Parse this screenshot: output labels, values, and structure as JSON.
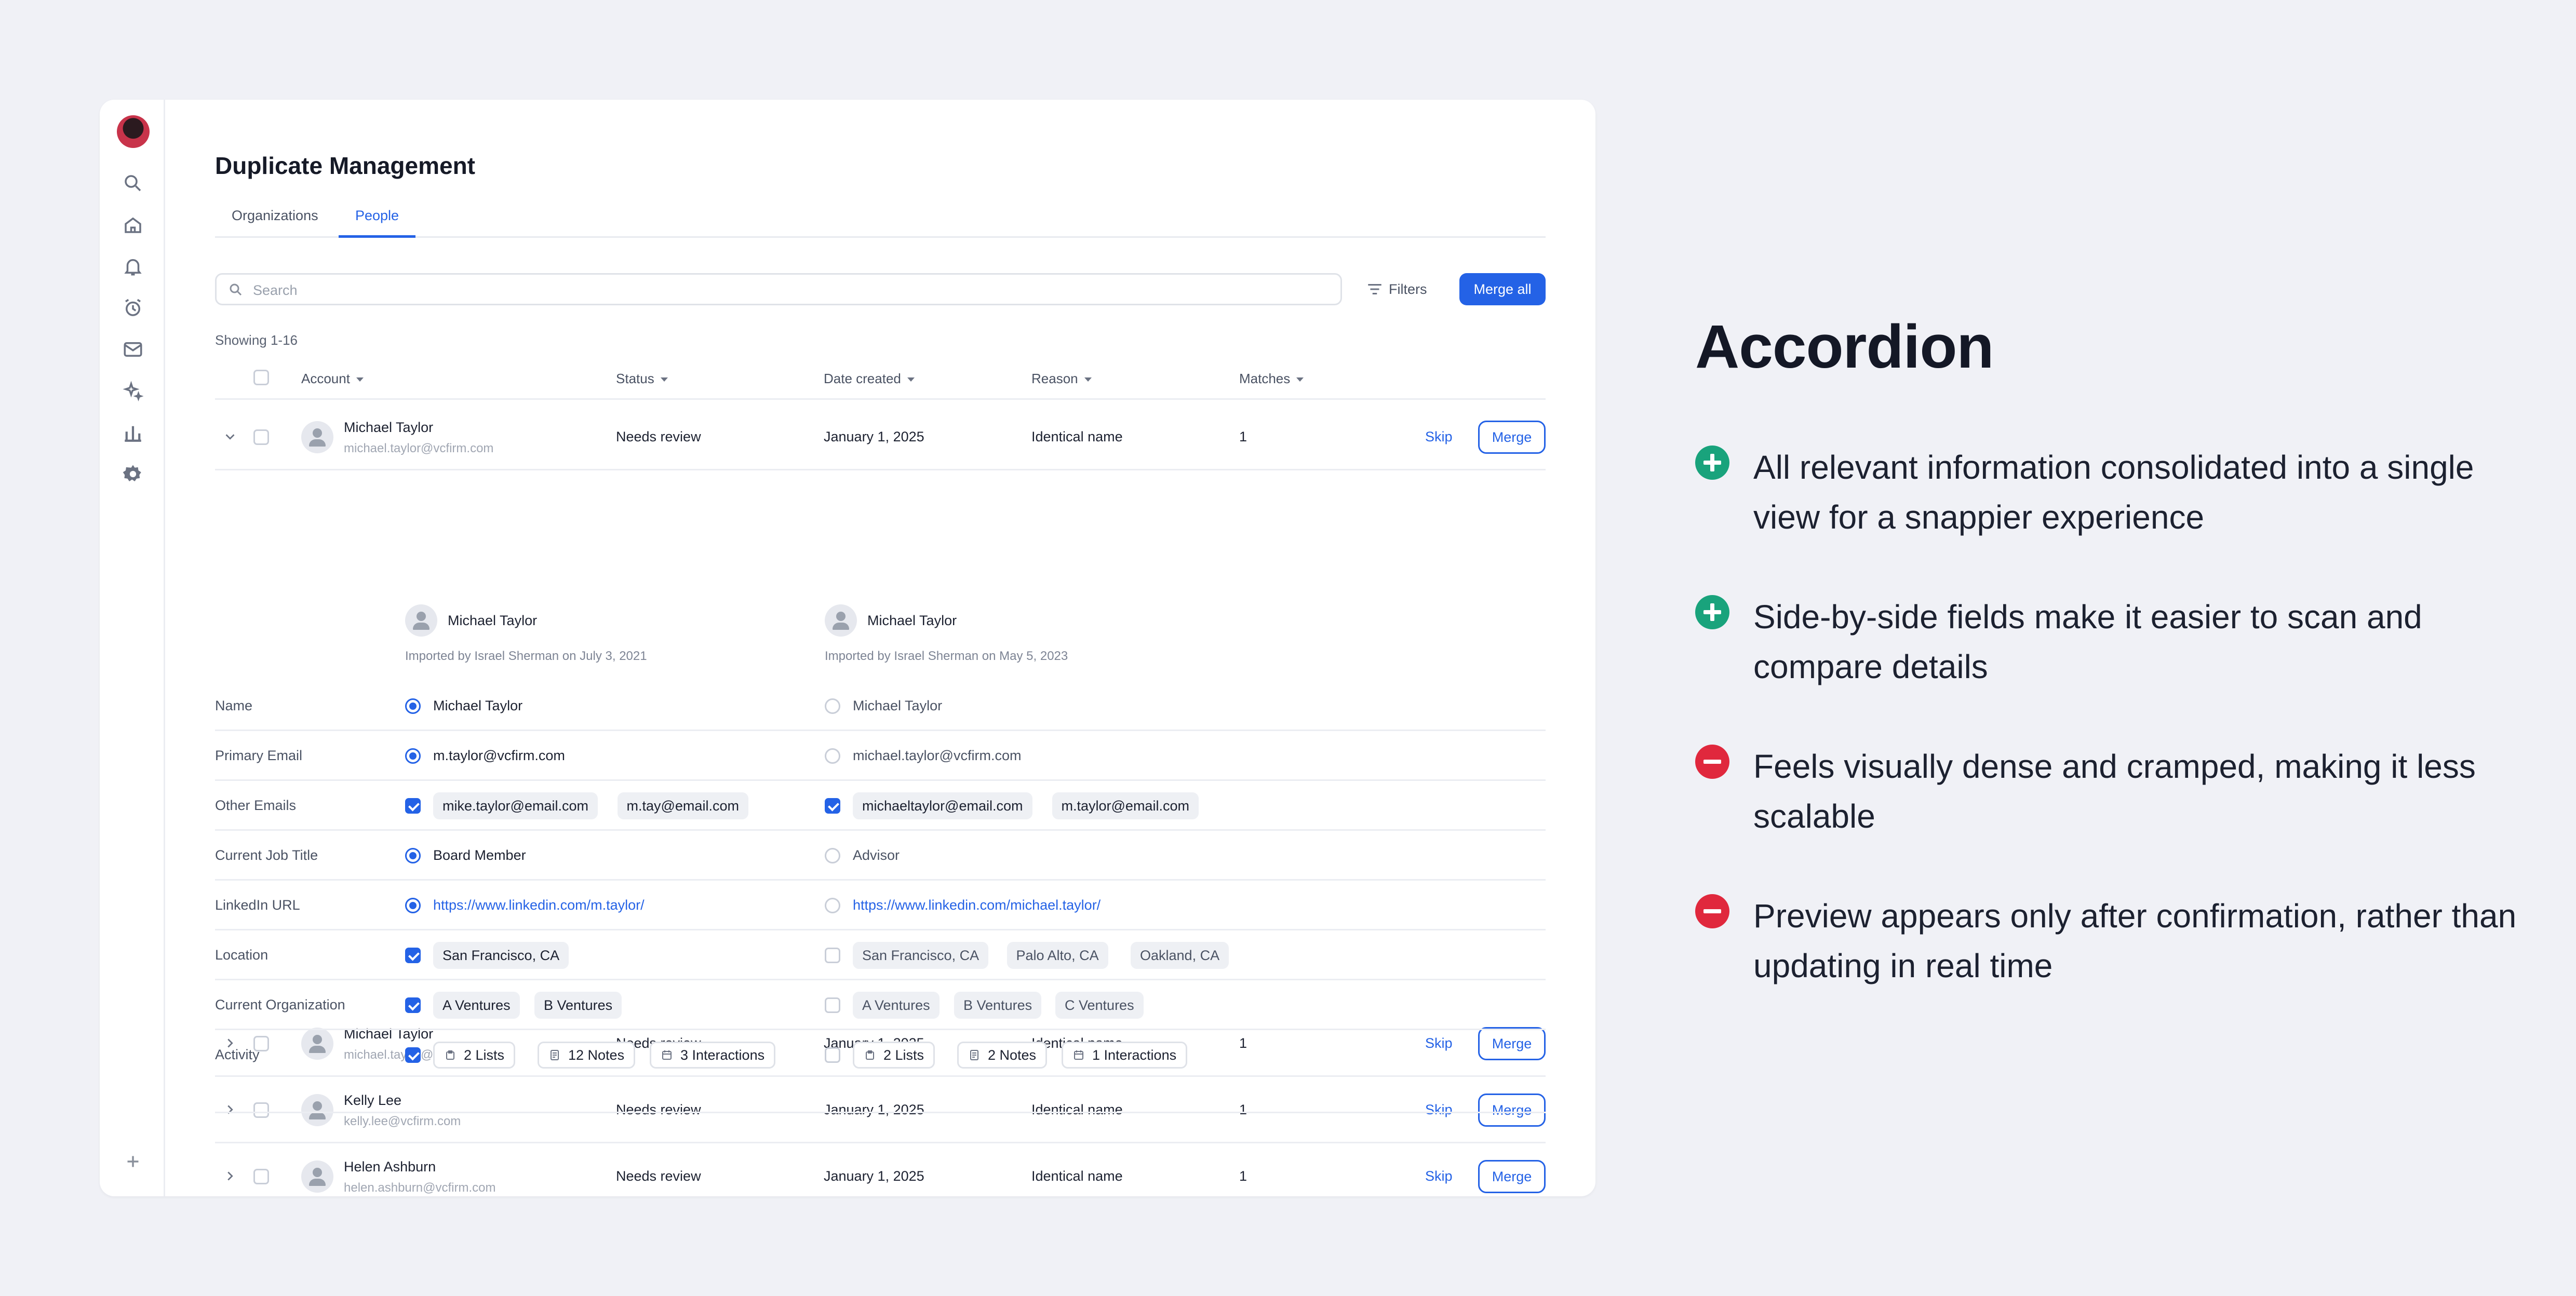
{
  "app": {
    "title": "Duplicate Management",
    "tabs": [
      {
        "label": "Organizations"
      },
      {
        "label": "People"
      }
    ],
    "search_placeholder": "Search",
    "filters_label": "Filters",
    "merge_all_label": "Merge all",
    "showing": "Showing 1-16",
    "columns": {
      "account": "Account",
      "status": "Status",
      "date": "Date created",
      "reason": "Reason",
      "matches": "Matches"
    },
    "rows": [
      {
        "name": "Michael Taylor",
        "email": "michael.taylor@vcfirm.com",
        "status": "Needs review",
        "date": "January 1, 2025",
        "reason": "Identical name",
        "matches": "1",
        "skip": "Skip",
        "merge": "Merge",
        "expanded": true
      },
      {
        "name": "Michael Taylor",
        "email": "michael.taylor@vcfirm.com",
        "status": "Needs review",
        "date": "January 1, 2025",
        "reason": "Identical name",
        "matches": "1",
        "skip": "Skip",
        "merge": "Merge",
        "expanded": false
      },
      {
        "name": "Kelly Lee",
        "email": "kelly.lee@vcfirm.com",
        "status": "Needs review",
        "date": "January 1, 2025",
        "reason": "Identical name",
        "matches": "1",
        "skip": "Skip",
        "merge": "Merge",
        "expanded": false
      },
      {
        "name": "Helen Ashburn",
        "email": "helen.ashburn@vcfirm.com",
        "status": "Needs review",
        "date": "January 1, 2025",
        "reason": "Identical name",
        "matches": "1",
        "skip": "Skip",
        "merge": "Merge",
        "expanded": false
      }
    ],
    "compare": {
      "left": {
        "name": "Michael Taylor",
        "imported": "Imported by Israel Sherman on July 3, 2021"
      },
      "right": {
        "name": "Michael Taylor",
        "imported": "Imported by Israel Sherman on May 5, 2023"
      },
      "fields": [
        {
          "label": "Name",
          "control": "radio",
          "left_selected": true,
          "right_selected": false,
          "left": [
            "Michael Taylor"
          ],
          "right": [
            "Michael Taylor"
          ]
        },
        {
          "label": "Primary Email",
          "control": "radio",
          "left_selected": true,
          "right_selected": false,
          "left": [
            "m.taylor@vcfirm.com"
          ],
          "right": [
            "michael.taylor@vcfirm.com"
          ]
        },
        {
          "label": "Other Emails",
          "control": "checkbox",
          "left_selected": true,
          "right_selected": true,
          "left": [
            "mike.taylor@email.com",
            "m.tay@email.com"
          ],
          "right": [
            "michaeltaylor@email.com",
            "m.taylor@email.com"
          ]
        },
        {
          "label": "Current Job Title",
          "control": "radio",
          "left_selected": true,
          "right_selected": false,
          "left": [
            "Board Member"
          ],
          "right": [
            "Advisor"
          ]
        },
        {
          "label": "LinkedIn URL",
          "control": "radio",
          "left_selected": true,
          "right_selected": false,
          "left": [
            "https://www.linkedin.com/m.taylor/"
          ],
          "right": [
            "https://www.linkedin.com/michael.taylor/"
          ]
        },
        {
          "label": "Location",
          "control": "checkbox",
          "left_selected": true,
          "right_selected": false,
          "left": [
            "San Francisco, CA"
          ],
          "right": [
            "San Francisco, CA",
            "Palo Alto, CA",
            "Oakland, CA"
          ]
        },
        {
          "label": "Current Organization",
          "control": "checkbox",
          "left_selected": true,
          "right_selected": false,
          "left": [
            "A Ventures",
            "B Ventures"
          ],
          "right": [
            "A Ventures",
            "B Ventures",
            "C Ventures"
          ]
        },
        {
          "label": "Activity",
          "control": "checkbox",
          "left_selected": true,
          "right_selected": false,
          "left": [
            "2 Lists",
            "12 Notes",
            "3 Interactions"
          ],
          "right": [
            "2 Lists",
            "2 Notes",
            "1 Interactions"
          ]
        }
      ]
    }
  },
  "summary": {
    "title": "Accordion",
    "points": [
      {
        "type": "pro",
        "text": "All relevant information consolidated into a single view for a snappier experience"
      },
      {
        "type": "pro",
        "text": "Side-by-side fields make it easier to scan and compare details"
      },
      {
        "type": "con",
        "text": "Feels visually dense and cramped, making it less scalable"
      },
      {
        "type": "con",
        "text": "Preview appears only after confirmation, rather than updating in real time"
      }
    ]
  },
  "colors": {
    "accent": "#2462e6",
    "pro": "#19a37c",
    "con": "#e0283d",
    "background": "#f0f1f6"
  },
  "icons": [
    "search-icon",
    "home-icon",
    "bell-icon",
    "alarm-icon",
    "mail-icon",
    "sparkle-icon",
    "chart-icon",
    "gear-icon",
    "plus-icon",
    "filter-icon",
    "chevron-down-icon",
    "chevron-right-icon",
    "list-icon",
    "note-icon",
    "calendar-icon"
  ]
}
